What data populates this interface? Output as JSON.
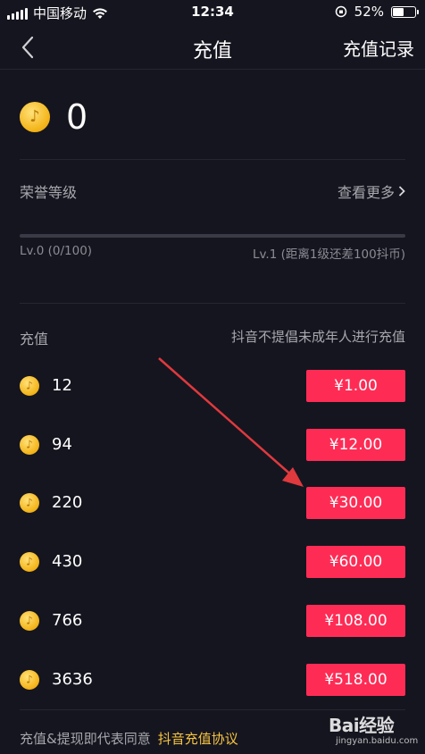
{
  "status_bar": {
    "carrier": "中国移动",
    "time": "12:34",
    "battery_text": "52%",
    "battery_level": 0.52
  },
  "nav": {
    "title": "充值",
    "record_label": "充值记录"
  },
  "balance": {
    "amount": "0"
  },
  "honor": {
    "label": "荣誉等级",
    "more_label": "查看更多",
    "progress": 0,
    "current_level": "Lv.0 (0/100)",
    "next_level": "Lv.1 (距离1级还差100抖币)"
  },
  "recharge": {
    "section_title": "充值",
    "notice": "抖音不提倡未成年人进行充值",
    "options": [
      {
        "coins": "12",
        "price": "¥1.00"
      },
      {
        "coins": "94",
        "price": "¥12.00"
      },
      {
        "coins": "220",
        "price": "¥30.00"
      },
      {
        "coins": "430",
        "price": "¥60.00"
      },
      {
        "coins": "766",
        "price": "¥108.00"
      },
      {
        "coins": "3636",
        "price": "¥518.00"
      }
    ]
  },
  "footer": {
    "agreement_prefix": "充值&提现即代表同意",
    "agreement_link": "抖音充值协议"
  },
  "watermark": {
    "brand": "Bai经验",
    "url": "jingyan.baidu.com"
  },
  "colors": {
    "accent": "#fe2c55",
    "background": "#15151f",
    "link": "#f6c441",
    "coin": "#f4b51b"
  }
}
